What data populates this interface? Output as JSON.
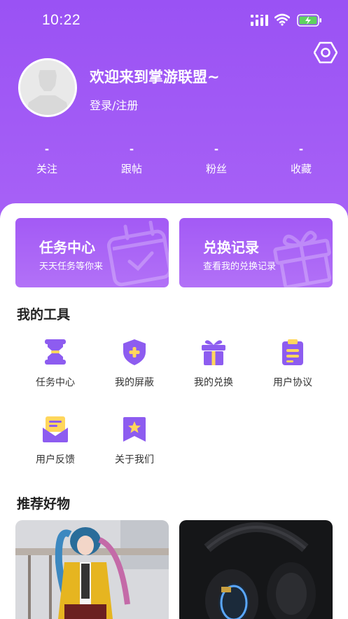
{
  "status_bar": {
    "time": "10:22"
  },
  "profile": {
    "welcome": "欢迎来到掌游联盟~",
    "login_link": "登录/注册"
  },
  "stats": [
    {
      "value": "-",
      "label": "关注"
    },
    {
      "value": "-",
      "label": "跟帖"
    },
    {
      "value": "-",
      "label": "粉丝"
    },
    {
      "value": "-",
      "label": "收藏"
    }
  ],
  "cards": [
    {
      "title": "任务中心",
      "subtitle": "天天任务等你来",
      "icon": "calendar-check-icon"
    },
    {
      "title": "兑换记录",
      "subtitle": "查看我的兑换记录",
      "icon": "gift-icon"
    }
  ],
  "tools_section": {
    "title": "我的工具",
    "items": [
      {
        "label": "任务中心",
        "icon": "hourglass-icon"
      },
      {
        "label": "我的屏蔽",
        "icon": "shield-plus-icon"
      },
      {
        "label": "我的兑换",
        "icon": "gift-box-icon"
      },
      {
        "label": "用户协议",
        "icon": "clipboard-icon"
      },
      {
        "label": "用户反馈",
        "icon": "envelope-icon"
      },
      {
        "label": "关于我们",
        "icon": "bookmark-star-icon"
      }
    ]
  },
  "recommend_section": {
    "title": "推荐好物",
    "items": [
      {
        "image": "cosplay-photo"
      },
      {
        "image": "gaming-headset-photo"
      }
    ]
  },
  "colors": {
    "brand_purple": "#a45cf6",
    "icon_purple": "#8d5cf0",
    "icon_yellow": "#ffd65c"
  }
}
